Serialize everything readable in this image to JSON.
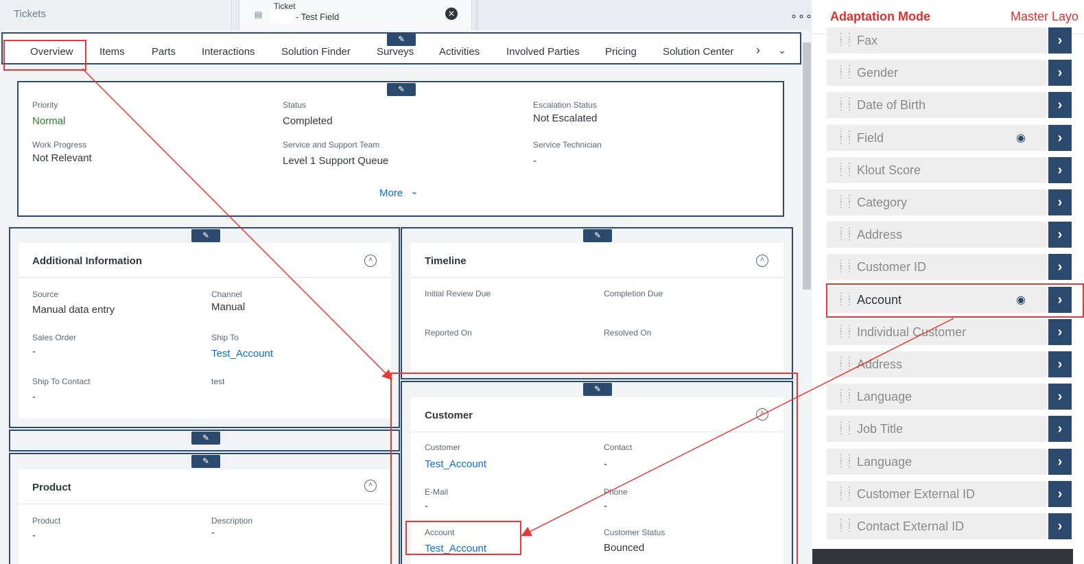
{
  "tabs": {
    "tickets_label": "Tickets",
    "active_small": "Ticket",
    "active_name": "- Test Field",
    "more": "∘∘∘"
  },
  "nav": {
    "items": [
      "Overview",
      "Items",
      "Parts",
      "Interactions",
      "Solution Finder",
      "Surveys",
      "Activities",
      "Involved Parties",
      "Pricing",
      "Solution Center"
    ]
  },
  "header": {
    "priority_label": "Priority",
    "priority_value": "Normal",
    "status_label": "Status",
    "status_value": "Completed",
    "escalation_label": "Escalation Status",
    "escalation_value": "Not Escalated",
    "work_progress_label": "Work Progress",
    "work_progress_value": "Not Relevant",
    "team_label": "Service and Support Team",
    "team_value": "Level 1 Support Queue",
    "technician_label": "Service Technician",
    "technician_value": "-",
    "more_label": "More"
  },
  "additional": {
    "title": "Additional Information",
    "source_label": "Source",
    "source_value": "Manual data entry",
    "channel_label": "Channel",
    "channel_value": "Manual",
    "sales_order_label": "Sales Order",
    "sales_order_value": "-",
    "ship_to_label": "Ship To",
    "ship_to_value": "Test_Account",
    "ship_contact_label": "Ship To Contact",
    "ship_contact_value": "-",
    "test_label": "test"
  },
  "timeline": {
    "title": "Timeline",
    "initial_label": "Initial Review Due",
    "completion_label": "Completion Due",
    "reported_label": "Reported On",
    "resolved_label": "Resolved On"
  },
  "product": {
    "title": "Product",
    "product_label": "Product",
    "product_value": "-",
    "description_label": "Description",
    "description_value": "-"
  },
  "customer": {
    "title": "Customer",
    "customer_label": "Customer",
    "customer_value": "Test_Account",
    "contact_label": "Contact",
    "contact_value": "-",
    "email_label": "E-Mail",
    "email_value": "-",
    "phone_label": "Phone",
    "phone_value": "-",
    "account_label": "Account",
    "account_value": "Test_Account",
    "status_label": "Customer Status",
    "status_value": "Bounced"
  },
  "adaptation": {
    "title": "Adaptation Mode",
    "title2": "Master Layo",
    "items": [
      {
        "label": "Fax",
        "eye": false
      },
      {
        "label": "Gender",
        "eye": false
      },
      {
        "label": "Date of Birth",
        "eye": false
      },
      {
        "label": "Field",
        "eye": true
      },
      {
        "label": "Klout Score",
        "eye": false
      },
      {
        "label": "Category",
        "eye": false
      },
      {
        "label": "Address",
        "eye": false
      },
      {
        "label": "Customer ID",
        "eye": false
      },
      {
        "label": "Account",
        "eye": true
      },
      {
        "label": "Individual Customer",
        "eye": false
      },
      {
        "label": "Address",
        "eye": false
      },
      {
        "label": "Language",
        "eye": false
      },
      {
        "label": "Job Title",
        "eye": false
      },
      {
        "label": "Language",
        "eye": false
      },
      {
        "label": "Customer External ID",
        "eye": false
      },
      {
        "label": "Contact External ID",
        "eye": false
      }
    ]
  },
  "colors": {
    "frame": "#2c4a6e",
    "highlight": "#e53935",
    "link": "#0a6ed1"
  }
}
